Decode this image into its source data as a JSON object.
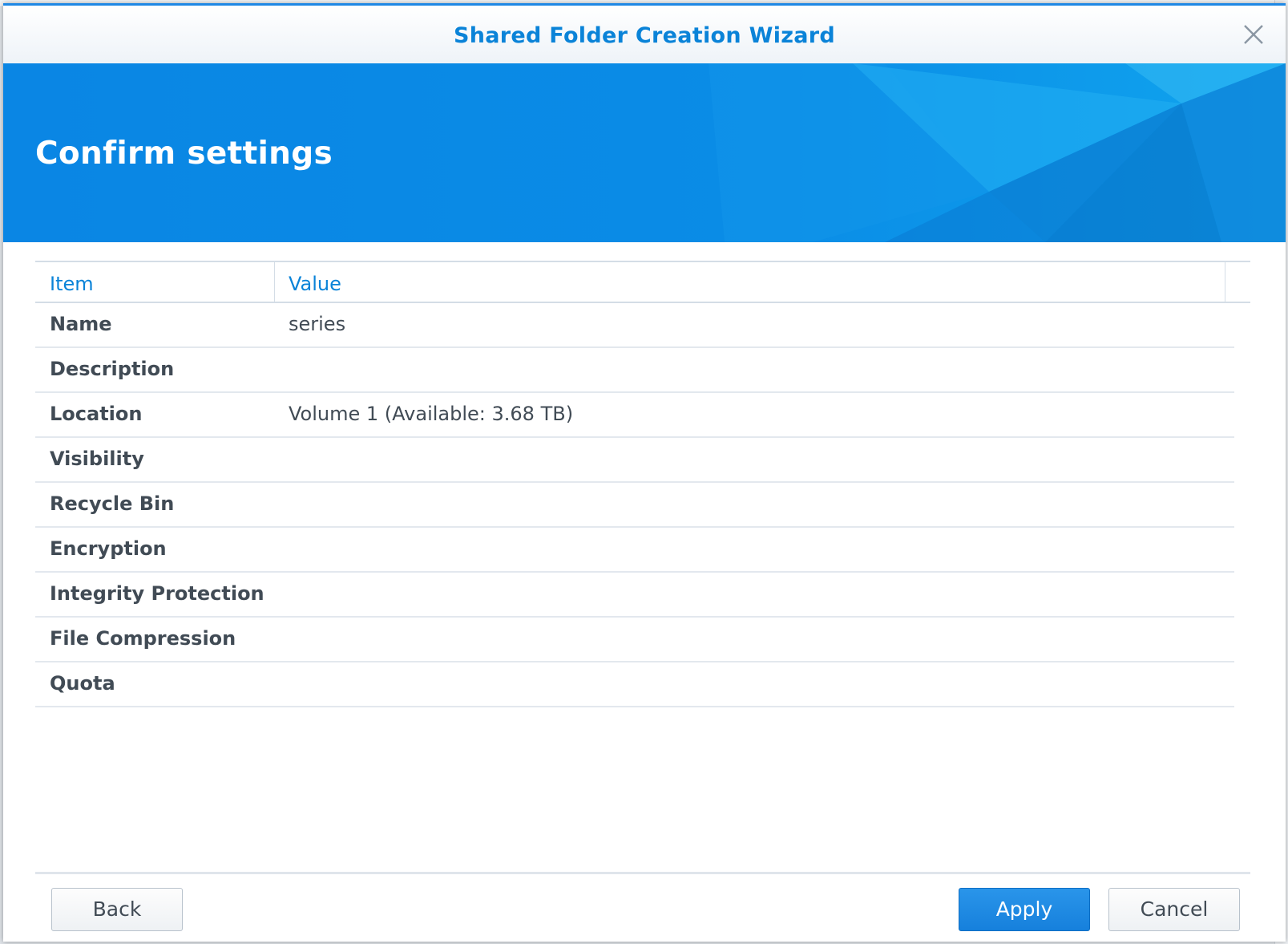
{
  "window": {
    "title": "Shared Folder Creation Wizard",
    "close_icon": "close-icon"
  },
  "banner": {
    "title": "Confirm settings"
  },
  "grid": {
    "columns": [
      "Item",
      "Value"
    ],
    "rows": [
      {
        "item": "Name",
        "value": "series"
      },
      {
        "item": "Description",
        "value": ""
      },
      {
        "item": "Location",
        "value": "Volume 1 (Available: 3.68 TB)"
      },
      {
        "item": "Visibility",
        "value": ""
      },
      {
        "item": "Recycle Bin",
        "value": ""
      },
      {
        "item": "Encryption",
        "value": ""
      },
      {
        "item": "Integrity Protection",
        "value": ""
      },
      {
        "item": "File Compression",
        "value": ""
      },
      {
        "item": "Quota",
        "value": ""
      }
    ]
  },
  "buttons": {
    "back": "Back",
    "apply": "Apply",
    "cancel": "Cancel"
  },
  "colors": {
    "accent": "#0a83d8",
    "banner": "#0a8ce6",
    "primary_button": "#1e88e5",
    "text": "#414b55"
  }
}
